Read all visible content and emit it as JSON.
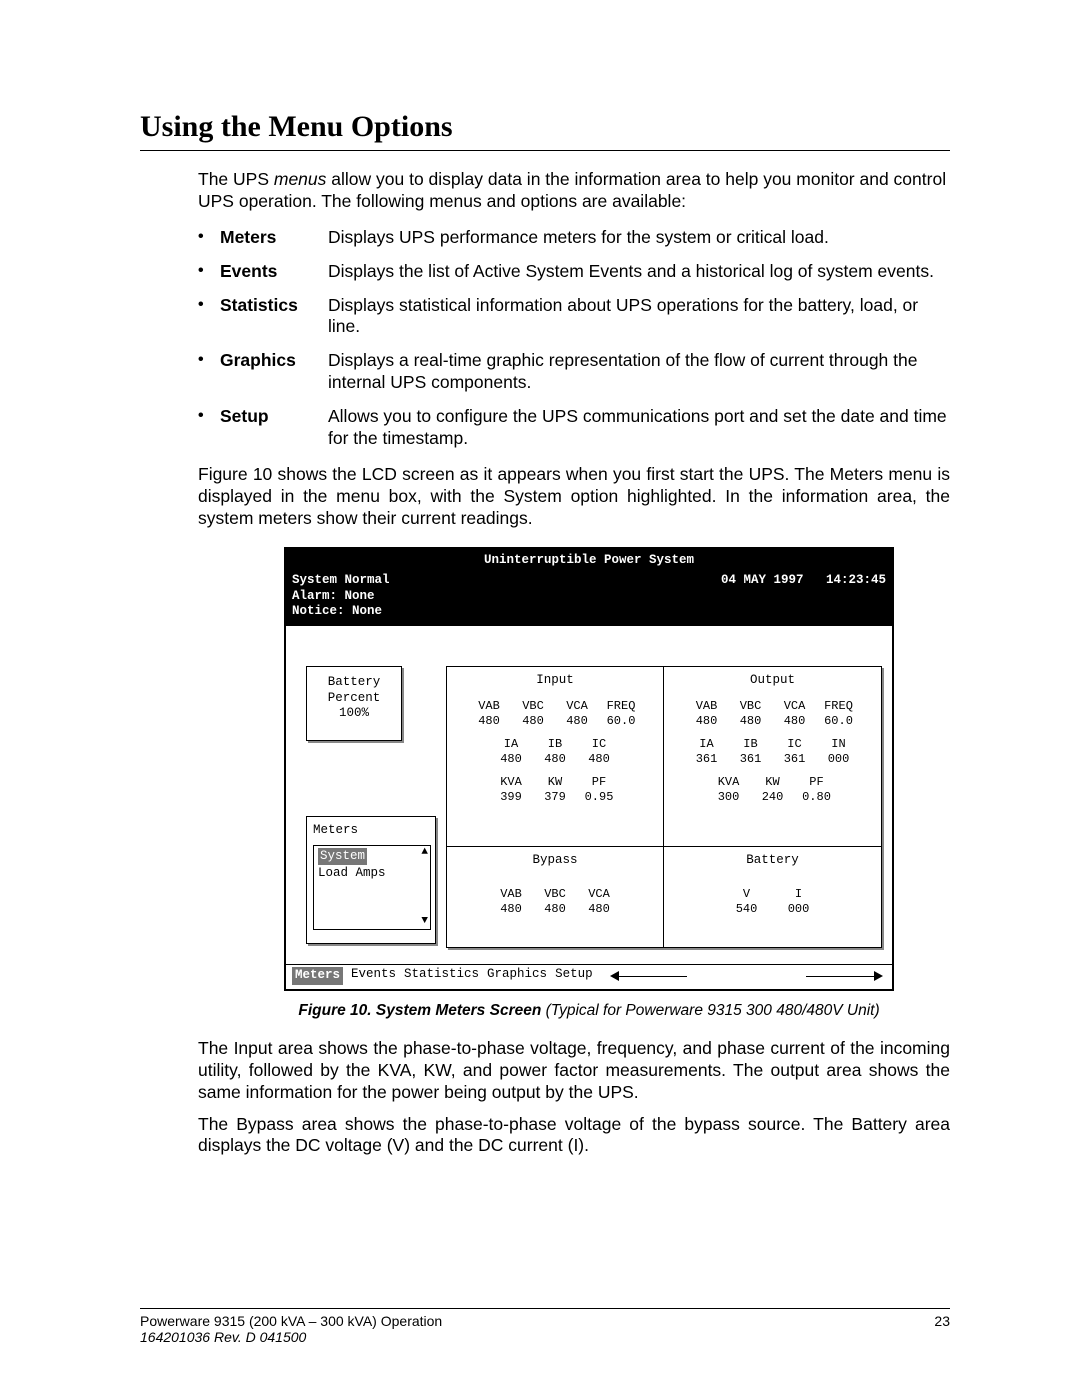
{
  "section_title": "Using the Menu Options",
  "intro_before_emph": "The UPS ",
  "intro_emph": "menus",
  "intro_after_emph": " allow you to display data in the information area to help you monitor and control UPS operation.  The following menus and options are available:",
  "menu_items": [
    {
      "term": "Meters",
      "desc": "Displays UPS performance meters for the system or critical load."
    },
    {
      "term": "Events",
      "desc": "Displays the list of Active System Events and a historical log of system events."
    },
    {
      "term": "Statistics",
      "desc": "Displays statistical information about UPS operations for the battery, load, or line."
    },
    {
      "term": "Graphics",
      "desc": "Displays a real-time graphic representation of the flow of current through the internal UPS components."
    },
    {
      "term": "Setup",
      "desc": "Allows you to configure the UPS communications port and set the date and time for the timestamp."
    }
  ],
  "para_after_list": "Figure 10 shows the LCD screen as it appears when you first start the UPS.  The Meters menu is displayed in the menu box, with the System option highlighted.  In the information area, the system meters show their current readings.",
  "lcd": {
    "title": "Uninterruptible Power System",
    "status": {
      "system": "System Normal",
      "alarm": "Alarm:  None",
      "notice": "Notice: None",
      "date": "04 MAY 1997",
      "time": "14:23:45"
    },
    "battery": {
      "l1": "Battery",
      "l2": "Percent",
      "l3": "100%"
    },
    "meters_box": {
      "title": "Meters",
      "selected": "System",
      "second": "Load Amps"
    },
    "quad": {
      "input": {
        "label": "Input",
        "h1": [
          "VAB",
          "VBC",
          "VCA",
          "FREQ"
        ],
        "v1": [
          "480",
          "480",
          "480",
          "60.0"
        ],
        "h2": [
          "IA",
          "IB",
          "IC"
        ],
        "v2": [
          "480",
          "480",
          "480"
        ],
        "h3": [
          "KVA",
          "KW",
          "PF"
        ],
        "v3": [
          "399",
          "379",
          "0.95"
        ]
      },
      "output": {
        "label": "Output",
        "h1": [
          "VAB",
          "VBC",
          "VCA",
          "FREQ"
        ],
        "v1": [
          "480",
          "480",
          "480",
          "60.0"
        ],
        "h2": [
          "IA",
          "IB",
          "IC",
          "IN"
        ],
        "v2": [
          "361",
          "361",
          "361",
          "000"
        ],
        "h3": [
          "KVA",
          "KW",
          "PF"
        ],
        "v3": [
          "300",
          "240",
          "0.80"
        ]
      },
      "bypass": {
        "label": "Bypass",
        "h1": [
          "VAB",
          "VBC",
          "VCA"
        ],
        "v1": [
          "480",
          "480",
          "480"
        ]
      },
      "battery": {
        "label": "Battery",
        "h1": [
          "V",
          "I"
        ],
        "v1": [
          "540",
          "000"
        ]
      }
    },
    "footer_tabs": [
      "Meters",
      "Events",
      "Statistics",
      "Graphics",
      "Setup"
    ],
    "footer_active": "Meters"
  },
  "figure_caption_bold": "Figure 10.  System Meters Screen",
  "figure_caption_italic": " (Typical for Powerware 9315 300 480/480V Unit)",
  "para_input": "The Input area shows the phase-to-phase voltage, frequency, and phase current of the incoming utility, followed by the KVA, KW, and power factor measurements.  The output area shows the same information for the power being output by the UPS.",
  "para_bypass": "The Bypass area shows the phase-to-phase voltage of the bypass source.  The Battery area displays the DC voltage (V) and the DC current (I).",
  "footer": {
    "doc1": "Powerware 9315 (200 kVA – 300 kVA) Operation",
    "doc2": "164201036  Rev. D  041500",
    "page": "23"
  }
}
